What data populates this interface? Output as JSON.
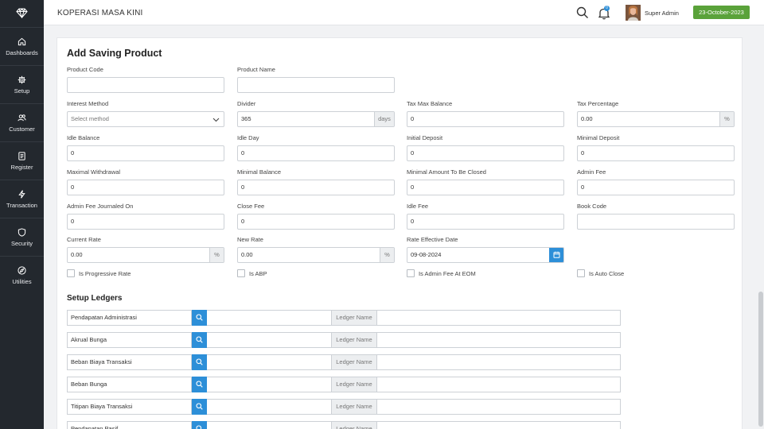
{
  "app": {
    "title": "KOPERASI MASA KINI"
  },
  "header": {
    "user_name": "Super Admin",
    "date": "23-October-2023",
    "notification_count": "0"
  },
  "sidebar": {
    "items": [
      {
        "label": "Dashboards",
        "icon": "home-icon"
      },
      {
        "label": "Setup",
        "icon": "gear-icon"
      },
      {
        "label": "Customer",
        "icon": "users-icon"
      },
      {
        "label": "Register",
        "icon": "document-icon"
      },
      {
        "label": "Transaction",
        "icon": "bolt-icon"
      },
      {
        "label": "Security",
        "icon": "shield-icon"
      },
      {
        "label": "Utilities",
        "icon": "compass-icon"
      }
    ]
  },
  "form": {
    "title": "Add Saving Product",
    "product_code": {
      "label": "Product Code",
      "value": ""
    },
    "product_name": {
      "label": "Product Name",
      "value": ""
    },
    "interest_method": {
      "label": "Interest Method",
      "placeholder": "Select method"
    },
    "divider": {
      "label": "Divider",
      "value": "365",
      "addon": "days"
    },
    "tax_max_balance": {
      "label": "Tax Max Balance",
      "value": "0"
    },
    "tax_percentage": {
      "label": "Tax Percentage",
      "value": "0.00",
      "addon": "%"
    },
    "idle_balance": {
      "label": "Idle Balance",
      "value": "0"
    },
    "idle_day": {
      "label": "Idle Day",
      "value": "0"
    },
    "initial_deposit": {
      "label": "Initial Deposit",
      "value": "0"
    },
    "minimal_deposit": {
      "label": "Minimal Deposit",
      "value": "0"
    },
    "maximal_withdrawal": {
      "label": "Maximal Withdrawal",
      "value": "0"
    },
    "minimal_balance": {
      "label": "Minimal Balance",
      "value": "0"
    },
    "minimal_amount_to_be_closed": {
      "label": "Minimal Amount To Be Closed",
      "value": "0"
    },
    "admin_fee": {
      "label": "Admin Fee",
      "value": "0"
    },
    "admin_fee_journaled_on": {
      "label": "Admin Fee Journaled On",
      "value": "0"
    },
    "close_fee": {
      "label": "Close Fee",
      "value": "0"
    },
    "idle_fee": {
      "label": "Idle Fee",
      "value": "0"
    },
    "book_code": {
      "label": "Book Code",
      "value": ""
    },
    "current_rate": {
      "label": "Current Rate",
      "value": "0.00",
      "addon": "%"
    },
    "new_rate": {
      "label": "New Rate",
      "value": "0.00",
      "addon": "%"
    },
    "rate_effective_date": {
      "label": "Rate Effective Date",
      "value": "09-08-2024"
    },
    "checkboxes": {
      "is_progressive_rate": "Is Progressive Rate",
      "is_abp": "Is ABP",
      "is_admin_fee_at_eom": "Is Admin Fee At EOM",
      "is_auto_close": "Is Auto Close"
    }
  },
  "ledgers": {
    "title": "Setup Ledgers",
    "name_label": "Ledger Name",
    "rows": [
      "Pendapatan Administrasi",
      "Akrual Bunga",
      "Beban Biaya Transaksi",
      "Beban Bunga",
      "Titipan Biaya Transaksi",
      "Pendapatan Pasif"
    ]
  }
}
